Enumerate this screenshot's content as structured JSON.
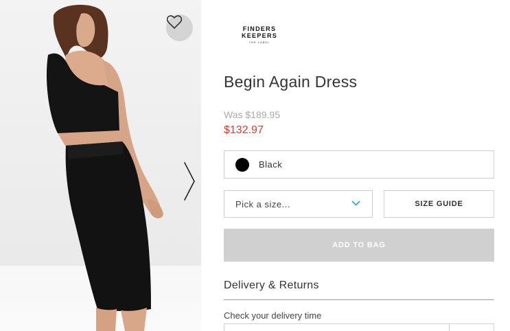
{
  "product_image": {
    "alt": "Model wearing black dress, back view"
  },
  "wishlist": {
    "icon": "heart-outline-icon"
  },
  "gallery": {
    "next_icon": "chevron-right-icon"
  },
  "brand": {
    "name": "FINDERS KEEPERS",
    "sub": "THE LABEL"
  },
  "product": {
    "title": "Begin Again Dress",
    "was_price": "Was $189.95",
    "sale_price": "$132.97",
    "sale_color": "#e2372f"
  },
  "colour": {
    "label": "Black",
    "swatch": "#000000"
  },
  "size": {
    "placeholder": "Pick a size...",
    "chevron_color": "#3ba0d9",
    "guide_label": "SIZE GUIDE"
  },
  "cart": {
    "add_label": "ADD TO BAG"
  },
  "delivery": {
    "heading": "Delivery & Returns",
    "check_label": "Check your delivery time"
  }
}
